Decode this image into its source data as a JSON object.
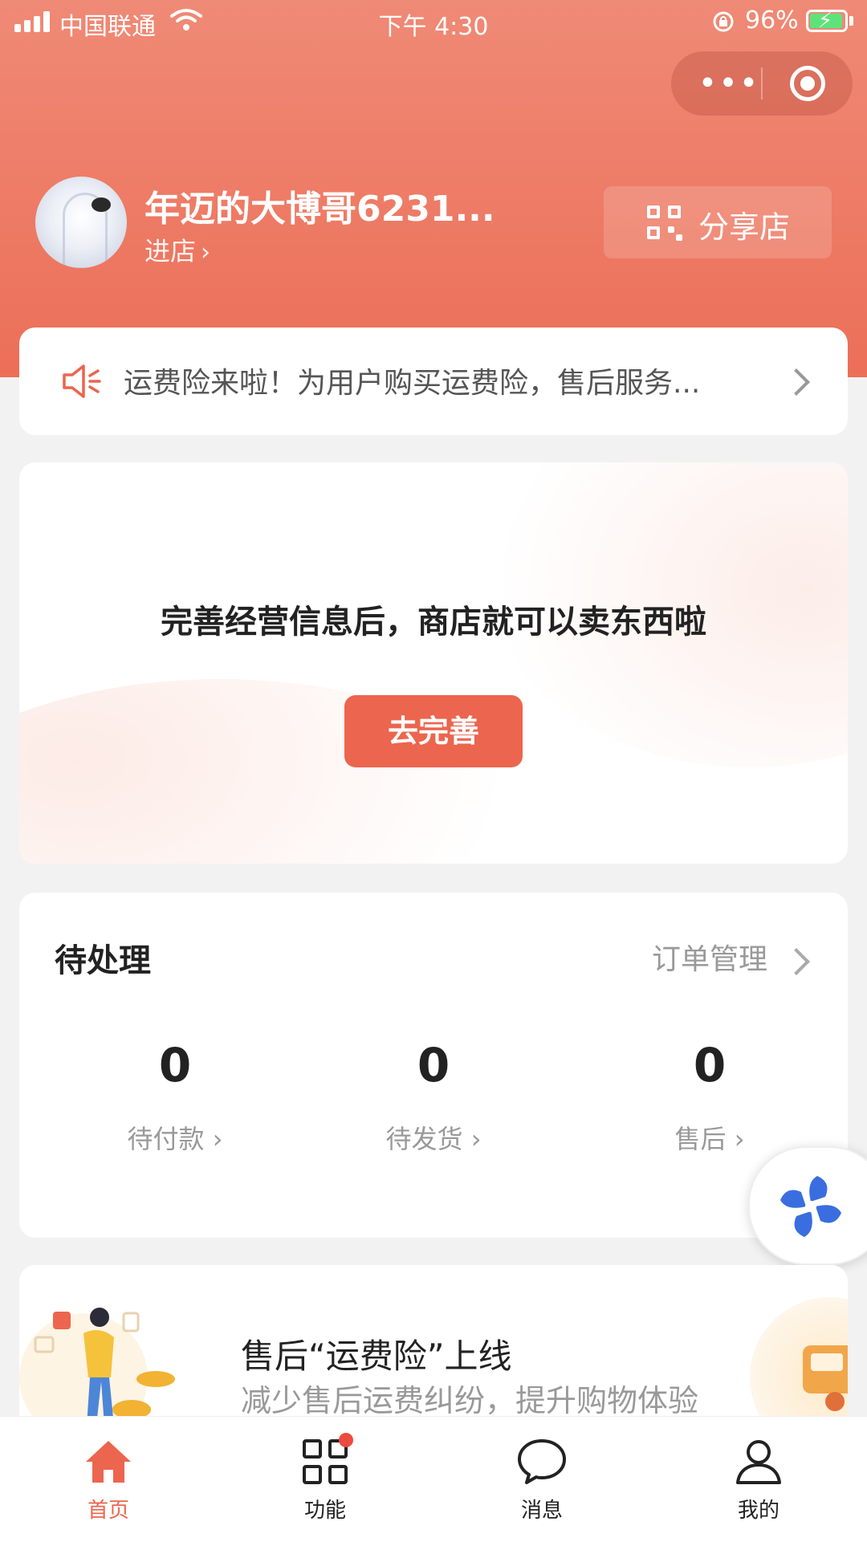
{
  "status_bar": {
    "carrier": "中国联通",
    "time": "下午 4:30",
    "battery": "96%",
    "battery_level": 0.96
  },
  "shop": {
    "name": "年迈的大博哥6231...",
    "enter": "进店",
    "share_label": "分享店"
  },
  "notice": {
    "text": "运费险来啦！为用户购买运费险，售后服务..."
  },
  "promo": {
    "message": "完善经营信息后，商店就可以卖东西啦",
    "button": "去完善"
  },
  "pending": {
    "title": "待处理",
    "link": "订单管理",
    "items": [
      {
        "count": "0",
        "label": "待付款"
      },
      {
        "count": "0",
        "label": "待发货"
      },
      {
        "count": "0",
        "label": "售后"
      }
    ]
  },
  "insurance": {
    "title": "售后“运费险”上线",
    "subtitle": "减少售后运费纠纷，提升购物体验"
  },
  "tabbar": {
    "items": [
      {
        "label": "首页",
        "icon": "home-icon",
        "active": true
      },
      {
        "label": "功能",
        "icon": "grid-icon",
        "active": false,
        "badge": true
      },
      {
        "label": "消息",
        "icon": "chat-icon",
        "active": false
      },
      {
        "label": "我的",
        "icon": "user-icon",
        "active": false
      }
    ]
  },
  "colors": {
    "accent": "#ec654e",
    "header_top": "#ef8a76",
    "header_bottom": "#ec6f58",
    "float_icon": "#3a6ee0"
  }
}
